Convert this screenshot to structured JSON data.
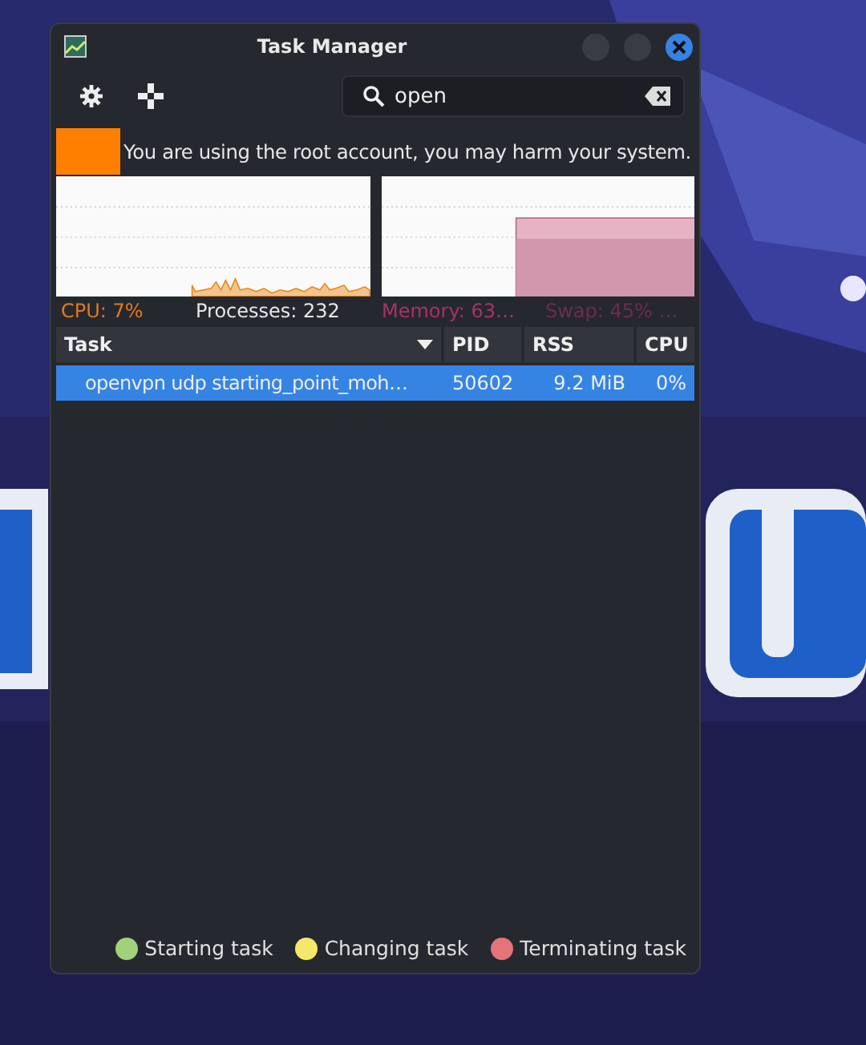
{
  "window": {
    "title": "Task Manager"
  },
  "search": {
    "value": "open"
  },
  "warning": {
    "text": "You are using the root account, you may harm your system."
  },
  "stats": {
    "cpu": "CPU: 7%",
    "processes": "Processes: 232",
    "memory": "Memory: 63…",
    "swap": "Swap: 45% …"
  },
  "table": {
    "columns": [
      {
        "label": "Task",
        "sorted": true
      },
      {
        "label": "PID",
        "sorted": false
      },
      {
        "label": "RSS",
        "sorted": false
      },
      {
        "label": "CPU",
        "sorted": false
      }
    ],
    "rows": [
      {
        "cells": [
          "openvpn udp starting_point_moh…",
          "50602",
          "9.2 MiB",
          "0%"
        ],
        "selected": true
      }
    ]
  },
  "legend": [
    {
      "label": "Starting task",
      "color": "#a3d07a"
    },
    {
      "label": "Changing task",
      "color": "#f5e76a"
    },
    {
      "label": "Terminating task",
      "color": "#e5737a"
    }
  ]
}
